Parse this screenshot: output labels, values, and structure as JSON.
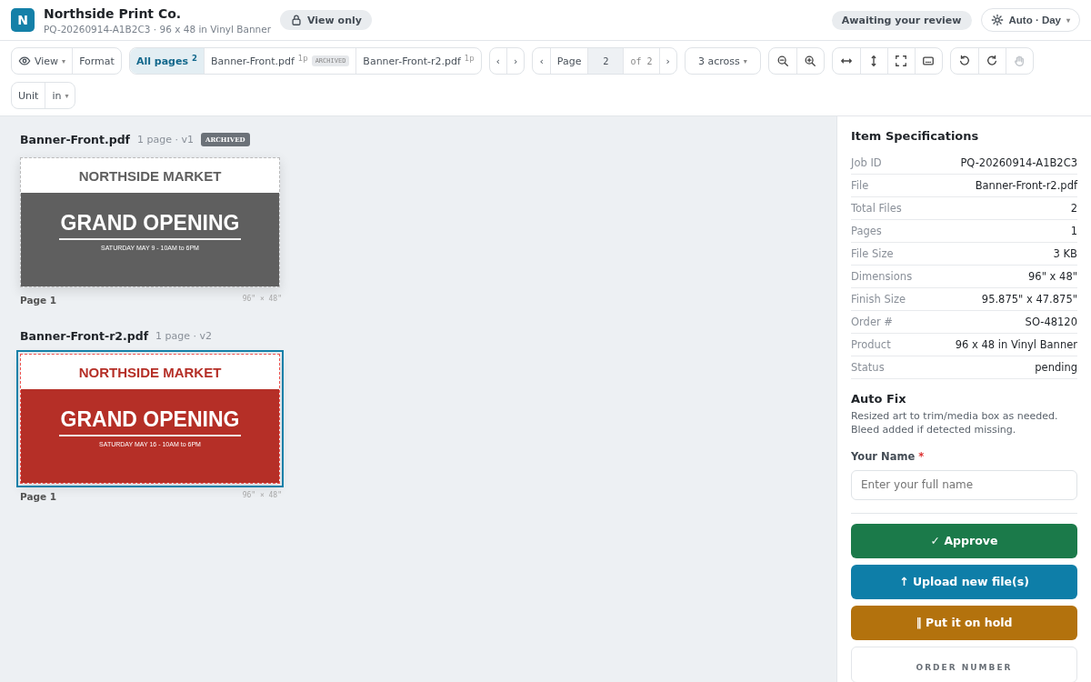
{
  "header": {
    "logo_letter": "N",
    "company": "Northside Print Co.",
    "subtitle": "PQ-20260914-A1B2C3 · 96 x 48 in Vinyl Banner",
    "access_badge": "View only",
    "status_badge": "Awaiting your review",
    "theme_button": "Auto · Day"
  },
  "toolbar": {
    "view_menu": "View",
    "format_button": "Format",
    "tabs": [
      {
        "label": "All pages",
        "count": "2",
        "selected": true
      },
      {
        "label": "Banner-Front.pdf",
        "count": "1p",
        "badge": "ARCHIVED",
        "selected": false
      },
      {
        "label": "Banner-Front-r2.pdf",
        "count": "1p",
        "selected": false
      }
    ],
    "prev": "‹",
    "next": "›",
    "pager": {
      "prev": "‹",
      "label": "Page",
      "value": "2",
      "total": "of 2",
      "next": "›"
    },
    "layout_select": "3 across",
    "caret": "▾",
    "tools": [
      {
        "kind": "zoom-out",
        "disabled": false
      },
      {
        "kind": "zoom-in",
        "disabled": false
      },
      {
        "kind": "fit-width",
        "disabled": false
      },
      {
        "kind": "fit-height",
        "disabled": false
      },
      {
        "kind": "fullscreen",
        "disabled": false
      },
      {
        "kind": "caption",
        "disabled": false
      },
      {
        "kind": "rotate-left",
        "disabled": false
      },
      {
        "kind": "rotate-right",
        "disabled": false
      },
      {
        "kind": "pan",
        "disabled": true
      }
    ],
    "unit_label": "Unit",
    "unit_value": "in"
  },
  "files": [
    {
      "name": "Banner-Front.pdf",
      "meta": "1 page · v1",
      "badge": "ARCHIVED",
      "selected": false,
      "color": "#5f5f5f",
      "banner": {
        "top": "NORTHSIDE MARKET",
        "headline": "GRAND OPENING",
        "subline": "SATURDAY MAY 9  -  10AM to 6PM"
      },
      "page_label": "Page 1",
      "size": "96\" × 48\""
    },
    {
      "name": "Banner-Front-r2.pdf",
      "meta": "1 page · v2",
      "selected": true,
      "color": "#b52f27",
      "banner": {
        "top": "NORTHSIDE MARKET",
        "headline": "GRAND OPENING",
        "subline": "SATURDAY MAY 16  -  10AM to 6PM"
      },
      "page_label": "Page 1",
      "size": "96\" × 48\""
    }
  ],
  "specs": {
    "title": "Item Specifications",
    "rows": [
      {
        "label": "Job ID",
        "value": "PQ-20260914-A1B2C3"
      },
      {
        "label": "File",
        "value": "Banner-Front-r2.pdf"
      },
      {
        "label": "Total Files",
        "value": "2"
      },
      {
        "label": "Pages",
        "value": "1"
      },
      {
        "label": "File Size",
        "value": "3 KB"
      },
      {
        "label": "Dimensions",
        "value": "96\" x 48\""
      },
      {
        "label": "Finish Size",
        "value": "95.875\" x 47.875\""
      },
      {
        "label": "Order #",
        "value": "SO-48120"
      },
      {
        "label": "Product",
        "value": "96 x 48 in Vinyl Banner"
      },
      {
        "label": "Status",
        "value": "pending"
      }
    ]
  },
  "auto_fix": {
    "title": "Auto Fix",
    "text": "Resized art to trim/media box as needed. Bleed added if detected missing."
  },
  "name_field": {
    "label": "Your Name",
    "required": "*",
    "placeholder": "Enter your full name"
  },
  "actions": [
    {
      "kind": "approve",
      "label": "✓ Approve"
    },
    {
      "kind": "upload",
      "label": "↑ Upload new file(s)"
    },
    {
      "kind": "hold",
      "label": "‖ Put it on hold"
    }
  ],
  "order_card": {
    "label": "ORDER NUMBER"
  }
}
